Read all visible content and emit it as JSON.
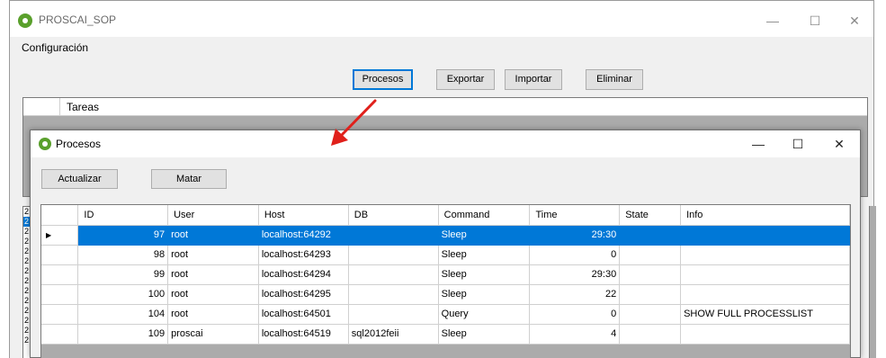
{
  "main_window": {
    "title": "PROSCAI_SOP",
    "controls": {
      "minimize": "—",
      "maximize": "☐",
      "close": "✕"
    }
  },
  "menu": {
    "items": [
      "Configuración"
    ]
  },
  "toolbar": {
    "buttons": [
      "Procesos",
      "Exportar",
      "Importar",
      "Eliminar"
    ]
  },
  "tasks_panel": {
    "header": "Tareas"
  },
  "left_grid_rows": [
    "2",
    "2",
    "2",
    "2",
    "2",
    "2",
    "2",
    "2",
    "2",
    "2",
    "2",
    "2",
    "2",
    "2"
  ],
  "dialog": {
    "title": "Procesos",
    "controls": {
      "minimize": "—",
      "maximize": "☐",
      "close": "✕"
    },
    "buttons": {
      "refresh": "Actualizar",
      "kill": "Matar"
    },
    "row_indicator": "▶",
    "columns": [
      "ID",
      "User",
      "Host",
      "DB",
      "Command",
      "Time",
      "State",
      "Info"
    ],
    "rows": [
      {
        "id": "97",
        "user": "root",
        "host": "localhost:64292",
        "db": "",
        "command": "Sleep",
        "time": "29:30",
        "state": "",
        "info": ""
      },
      {
        "id": "98",
        "user": "root",
        "host": "localhost:64293",
        "db": "",
        "command": "Sleep",
        "time": "0",
        "state": "",
        "info": ""
      },
      {
        "id": "99",
        "user": "root",
        "host": "localhost:64294",
        "db": "",
        "command": "Sleep",
        "time": "29:30",
        "state": "",
        "info": ""
      },
      {
        "id": "100",
        "user": "root",
        "host": "localhost:64295",
        "db": "",
        "command": "Sleep",
        "time": "22",
        "state": "",
        "info": ""
      },
      {
        "id": "104",
        "user": "root",
        "host": "localhost:64501",
        "db": "",
        "command": "Query",
        "time": "0",
        "state": "",
        "info": "SHOW FULL PROCESSLIST"
      },
      {
        "id": "109",
        "user": "proscai",
        "host": "localhost:64519",
        "db": "sql2012feii",
        "command": "Sleep",
        "time": "4",
        "state": "",
        "info": ""
      }
    ]
  },
  "colors": {
    "selection": "#0078d7",
    "annotation_arrow": "#e0201b",
    "app_icon": "#5aa02c",
    "window_bg": "#f0f0f0"
  }
}
